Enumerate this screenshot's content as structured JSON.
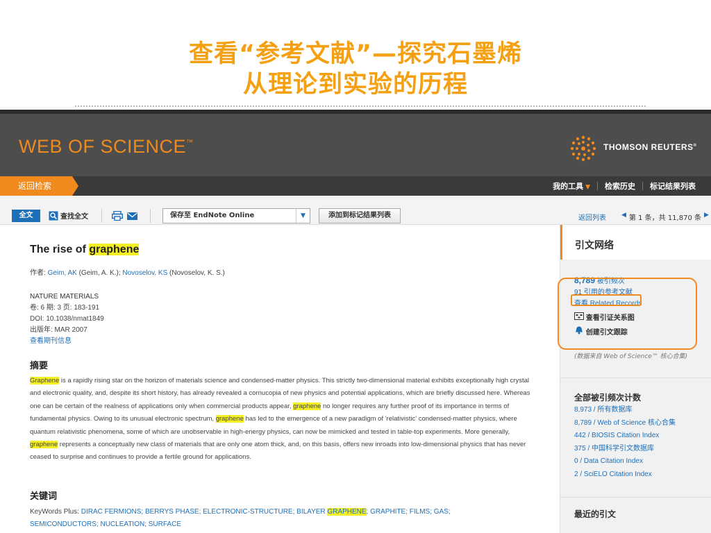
{
  "slide": {
    "title_line1": "查看“参考文献”—探究石墨烯",
    "title_line2": "从理论到实验的历程"
  },
  "header": {
    "logo": "WEB OF SCIENCE",
    "logo_tm": "™",
    "publisher": "THOMSON REUTERS",
    "publisher_tm": "®"
  },
  "nav": {
    "back": "返回检索",
    "my_tools": "我的工具",
    "history": "检索历史",
    "marked": "标记结果列表"
  },
  "toolbar": {
    "full_text": "全文",
    "find_full_text": "查找全文",
    "save_to": "保存至 EndNote Online",
    "add_marked": "添加到标记结果列表",
    "back_to_list": "返回列表",
    "pager": "第 1 条，共 11,870 条"
  },
  "record": {
    "title_pre": "The rise of ",
    "title_hl": "graphene",
    "authors_label": "作者:",
    "author1_link": "Geim, AK",
    "author1_full": "(Geim, A. K.);",
    "author2_link": "Novoselov, KS",
    "author2_full": "(Novoselov, K. S.)",
    "journal": "NATURE MATERIALS",
    "volume_line": "卷: 6  期: 3  页: 183-191",
    "doi_line": "DOI: 10.1038/nmat1849",
    "year_line": "出版年: MAR 2007",
    "journal_info": "查看期刊信息",
    "abstract_heading": "摘要",
    "abs_1": "Graphene",
    "abs_2": " is a rapidly rising star on the horizon of materials science and condensed-matter physics. This strictly two-dimensional material exhibits exceptionally high crystal and electronic quality, and, despite its short history, has already revealed a cornucopia of new physics and potential applications, which are briefly discussed here. Whereas one can be certain of the realness of applications only when commercial products appear, ",
    "abs_3": "graphene",
    "abs_4": " no longer requires any further proof of its importance in terms of fundamental physics. Owing to its unusual electronic spectrum, ",
    "abs_5": "graphene",
    "abs_6": " has led to the emergence of a new paradigm of 'relativistic' condensed-matter physics, where quantum relativistic phenomena, some of which are unobservable in high-energy physics, can now be mimicked and tested in table-top experiments. More generally, ",
    "abs_7": "graphene",
    "abs_8": " represents a conceptually new class of materials that are only one atom thick, and, on this basis, offers new inroads into low-dimensional physics that has never ceased to surprise and continues to provide a fertile ground for applications.",
    "keywords_heading": "关键词",
    "kw_label": "KeyWords Plus:",
    "kw_1": "DIRAC FERMIONS; BERRYS PHASE; ELECTRONIC-STRUCTURE; BILAYER ",
    "kw_hl": "GRAPHENE",
    "kw_2": "; GRAPHITE; FILMS; GAS; SEMICONDUCTORS; NUCLEATION; SURFACE"
  },
  "side": {
    "heading": "引文网络",
    "times_cited_num": "8,789",
    "times_cited_label": "被引频次",
    "cited_refs": "91 引用的参考文献",
    "related": "查看 Related Records",
    "citation_map": "查看引证关系图",
    "create_alert": "创建引文跟踪",
    "note": "(数据来自 Web of Science™ 核心合集)",
    "all_counts_heading": "全部被引频次计数",
    "counts": [
      "8,973 / 所有数据库",
      "8,789 / Web of Science 核心合集",
      "442 / BIOSIS Citation Index",
      "375 / 中国科学引文数据库",
      "0 / Data Citation Index",
      "2 / SciELO Citation Index"
    ],
    "recent_heading": "最近的引文"
  }
}
